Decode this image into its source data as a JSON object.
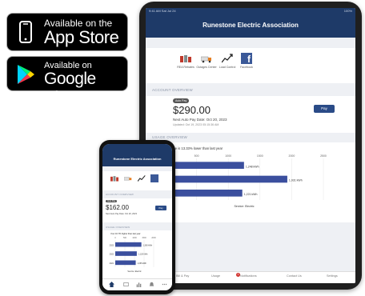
{
  "app_store": {
    "line1": "Available on the",
    "line2": "App Store"
  },
  "google_play": {
    "line1": "Available on",
    "line2": "Google Play"
  },
  "tablet": {
    "status_left": "9:41 AM Sat Jul 24",
    "status_right": "100%",
    "title": "Runestone Electric Association",
    "quick_links": [
      {
        "label": "REA Rebates",
        "icon": "appliances-icon"
      },
      {
        "label": "Outages Center",
        "icon": "truck-icon"
      },
      {
        "label": "Load Control",
        "icon": "chart-trend-icon"
      },
      {
        "label": "Facebook",
        "icon": "facebook-icon"
      }
    ],
    "account_section": "ACCOUNT OVERVIEW",
    "autopay": "Auto Pay",
    "amount": "$290.00",
    "due_date": "Next Auto Pay Date: Oct 20, 2023",
    "updated": "Updated: Oct 19, 2023 05:15:36 AM",
    "pay_button": "Pay",
    "usage_section": "USAGE OVERVIEW",
    "usage_note": "Your usage is 13.33% lower than last year",
    "tabs": [
      "Home",
      "Bill & Pay",
      "Usage",
      "Notifications",
      "Contact Us",
      "Settings"
    ],
    "notification_count": "1"
  },
  "phone": {
    "title": "Runestone Electric Association",
    "account_section": "ACCOUNT OVERVIEW",
    "autopay": "Auto Pay",
    "amount": "$162.00",
    "due_date": "Next Auto Pay Date: Oct 20, 2023",
    "pay_button": "Pay",
    "usage_section": "USAGE OVERVIEW",
    "usage_note": "Your 16.7% higher than last year"
  },
  "chart_data": [
    {
      "type": "bar",
      "orientation": "horizontal",
      "categories": [
        "2023",
        "2022",
        "2021"
      ],
      "values": [
        1248,
        1931,
        1221
      ],
      "data_labels": [
        "1,248 kWh",
        "1,931 kWh",
        "1,221 kWh"
      ],
      "xlim": [
        0,
        2500
      ],
      "ticks": [
        "0",
        "500",
        "1000",
        "1500",
        "2000",
        "2500"
      ],
      "xlabel": "Service: Electric"
    },
    {
      "type": "bar",
      "orientation": "horizontal",
      "categories": [
        "2023",
        "2022",
        "2021"
      ],
      "values": [
        1360,
        1120,
        1065
      ],
      "data_labels": [
        "1,360 kWh",
        "1,120 kWh",
        "1,065 kWh"
      ],
      "xlim": [
        0,
        2000
      ],
      "ticks": [
        "0",
        "500",
        "1000",
        "1500",
        "2000"
      ],
      "xlabel": "Service: Electric"
    }
  ],
  "colors": {
    "brand": "#1e3a68",
    "bar": "#3b4f9e",
    "button": "#2a4b87"
  }
}
